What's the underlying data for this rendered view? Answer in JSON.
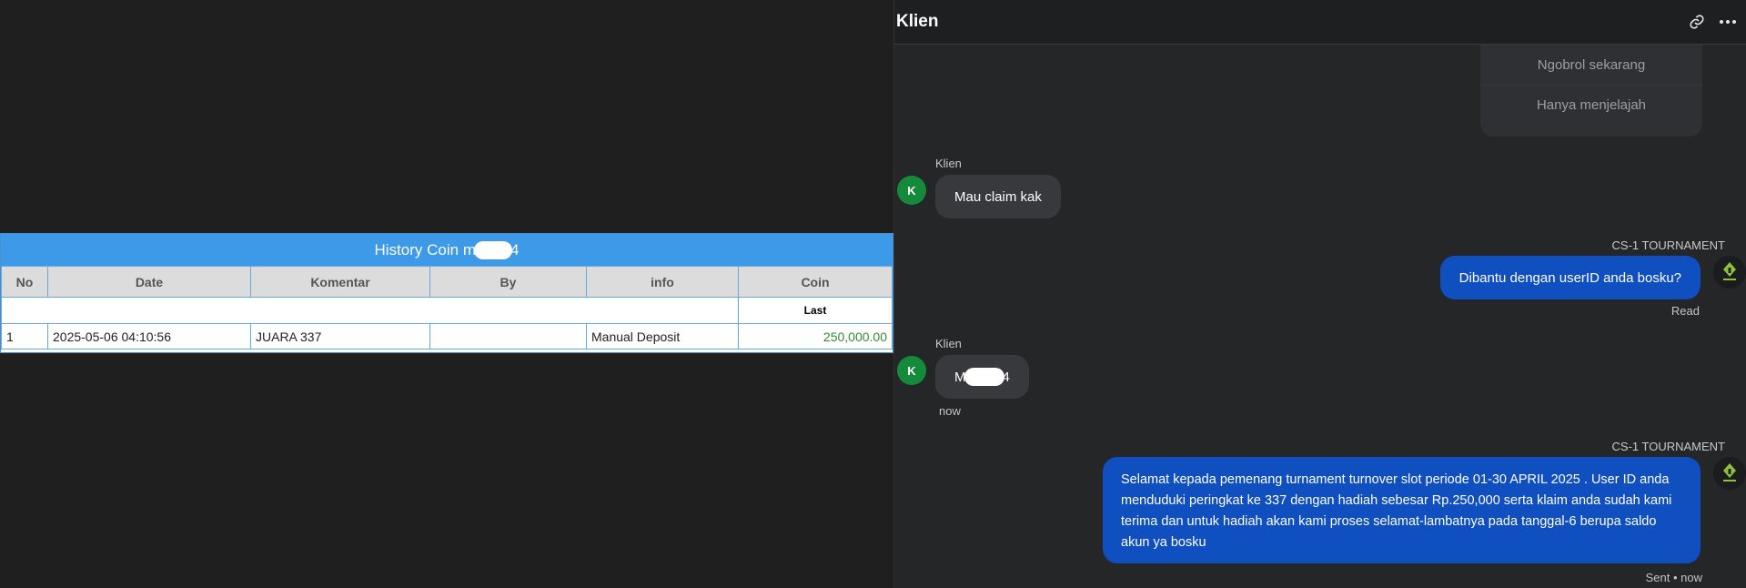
{
  "history": {
    "title_prefix": "History Coin m",
    "title_suffix": "4",
    "columns": [
      "No",
      "Date",
      "Komentar",
      "By",
      "info",
      "Coin"
    ],
    "subheader_last": "Last",
    "rows": [
      {
        "no": "1",
        "date": "2025-05-06 04:10:56",
        "komentar": "JUARA 337",
        "by": "",
        "info": "Manual Deposit",
        "coin": "250,000.00"
      }
    ]
  },
  "chat": {
    "title": "Klien",
    "quick_replies": [
      "Ngobrol sekarang",
      "Hanya menjelajah"
    ],
    "messages": {
      "m1": {
        "sender": "Klien",
        "avatar": "K",
        "text": "Mau claim kak"
      },
      "m2": {
        "sender": "CS-1 TOURNAMENT",
        "text": "Dibantu dengan userID anda bosku?",
        "status": "Read"
      },
      "m3": {
        "sender": "Klien",
        "avatar": "K",
        "text_prefix": "M",
        "text_suffix": "4",
        "time": "now"
      },
      "m4": {
        "sender": "CS-1 TOURNAMENT",
        "text": "Selamat kepada pemenang turnament turnover slot periode 01-30 APRIL 2025 . User ID anda menduduki peringkat ke 337 dengan hadiah sebesar Rp.250,000 serta klaim anda sudah kami terima dan untuk hadiah akan kami proses selamat-lambatnya pada tanggal-6 berupa saldo akun ya bosku",
        "status": "Sent • now"
      }
    }
  },
  "colors": {
    "table_header_blue": "#3d9ae8",
    "outgoing_bubble": "#0f4fc0",
    "incoming_bubble": "#38393d",
    "avatar_green": "#168a3b",
    "coin_green": "#2f8f2f"
  },
  "icons": {
    "header_link": "link-icon",
    "header_more": "more-horizontal-icon",
    "agent_avatar": "bot-logo-icon"
  }
}
